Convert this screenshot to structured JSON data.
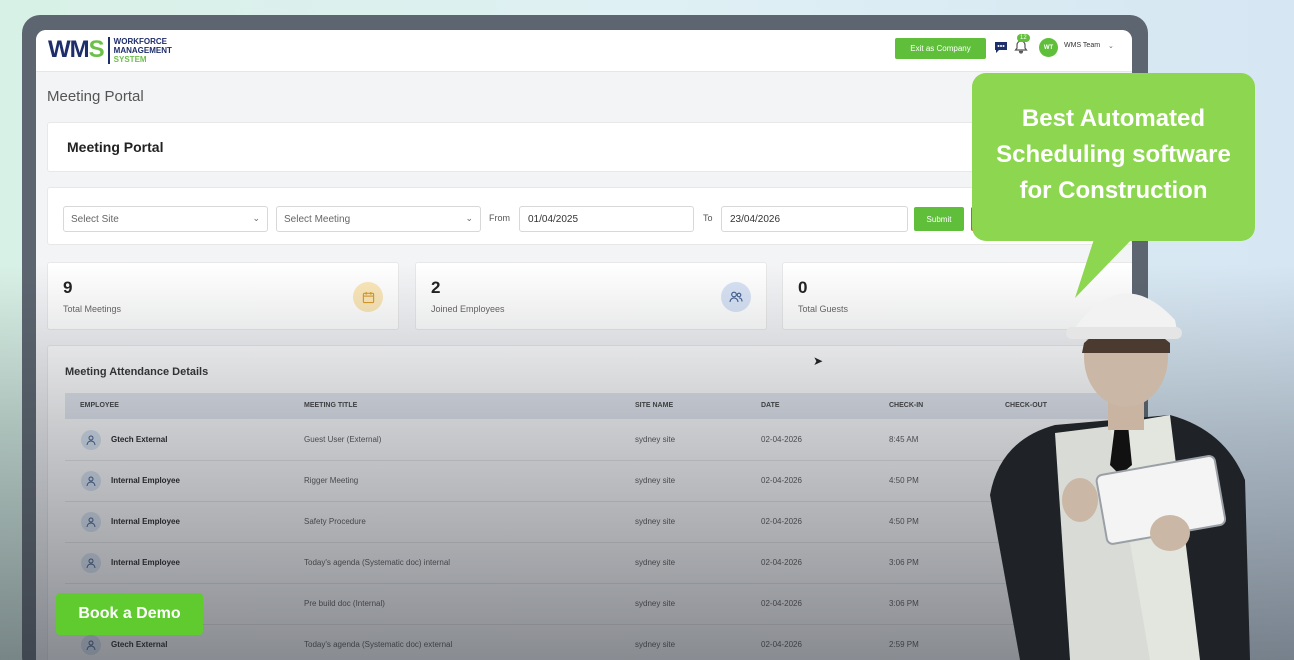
{
  "brand": {
    "logo_mark": "WMS",
    "logo_line1": "WORKFORCE",
    "logo_line2": "MANAGEMENT",
    "logo_line3": "SYSTEM"
  },
  "topbar": {
    "exit_label": "Exit as Company",
    "notification_count": "12",
    "user_initials": "WT",
    "user_name": "WMS Team"
  },
  "breadcrumb": "Meeting Portal",
  "header": {
    "title": "Meeting Portal"
  },
  "filters": {
    "site_placeholder": "Select Site",
    "meeting_placeholder": "Select Meeting",
    "from_label": "From",
    "from_value": "01/04/2025",
    "to_label": "To",
    "to_value": "23/04/2026",
    "submit_label": "Submit"
  },
  "stats": [
    {
      "value": "9",
      "label": "Total Meetings"
    },
    {
      "value": "2",
      "label": "Joined Employees"
    },
    {
      "value": "0",
      "label": "Total Guests"
    }
  ],
  "table": {
    "title": "Meeting Attendance Details",
    "columns": [
      "EMPLOYEE",
      "MEETING TITLE",
      "SITE NAME",
      "DATE",
      "CHECK-IN",
      "CHECK-OUT"
    ],
    "rows": [
      {
        "employee": "Gtech External",
        "title": "Guest User (External)",
        "site": "sydney site",
        "date": "02-04-2026",
        "checkin": "8:45 AM"
      },
      {
        "employee": "Internal Employee",
        "title": "Rigger Meeting",
        "site": "sydney site",
        "date": "02-04-2026",
        "checkin": "4:50 PM"
      },
      {
        "employee": "Internal Employee",
        "title": "Safety Procedure",
        "site": "sydney site",
        "date": "02-04-2026",
        "checkin": "4:50 PM"
      },
      {
        "employee": "Internal Employee",
        "title": "Today's agenda (Systematic doc) internal",
        "site": "sydney site",
        "date": "02-04-2026",
        "checkin": "3:06 PM"
      },
      {
        "employee": "",
        "title": "Pre build doc (Internal)",
        "site": "sydney site",
        "date": "02-04-2026",
        "checkin": "3:06 PM"
      },
      {
        "employee": "Gtech External",
        "title": "Today's agenda (Systematic doc) external",
        "site": "sydney site",
        "date": "02-04-2026",
        "checkin": "2:59 PM"
      }
    ]
  },
  "promo": {
    "bubble_line1": "Best Automated",
    "bubble_line2": "Scheduling software",
    "bubble_line3": "for Construction",
    "demo_label": "Book a Demo"
  },
  "colors": {
    "accent_green": "#5fbf3b",
    "bubble_green": "#8dd64f",
    "navy": "#1e2d6b"
  }
}
